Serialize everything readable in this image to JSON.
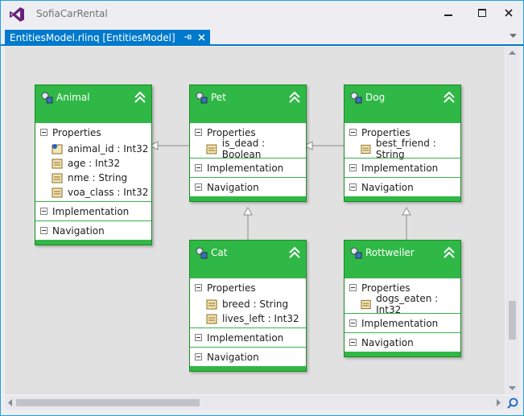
{
  "window": {
    "title": "SofiaCarRental",
    "accent": "#007acc",
    "controls": {
      "minimize": "—",
      "maximize": "☐",
      "close": "✕"
    }
  },
  "tab": {
    "label": "EntitiesModel.rlinq [EntitiesModel]",
    "pin": "⊣",
    "close": "✕"
  },
  "colors": {
    "entity_header": "#30b847",
    "canvas": "#e1e1e1"
  },
  "entities": {
    "animal": {
      "name": "Animal",
      "properties_label": "Properties",
      "properties": [
        {
          "label": "animal_id : Int32",
          "icon": "key-property-icon"
        },
        {
          "label": "age : Int32",
          "icon": "property-icon"
        },
        {
          "label": "nme : String",
          "icon": "property-icon"
        },
        {
          "label": "voa_class : Int32",
          "icon": "property-icon"
        }
      ],
      "implementation_label": "Implementation",
      "navigation_label": "Navigation"
    },
    "pet": {
      "name": "Pet",
      "properties_label": "Properties",
      "properties": [
        {
          "label": "is_dead : Boolean",
          "icon": "property-icon"
        }
      ],
      "implementation_label": "Implementation",
      "navigation_label": "Navigation"
    },
    "dog": {
      "name": "Dog",
      "properties_label": "Properties",
      "properties": [
        {
          "label": "best_friend : String",
          "icon": "property-icon"
        }
      ],
      "implementation_label": "Implementation",
      "navigation_label": "Navigation"
    },
    "cat": {
      "name": "Cat",
      "properties_label": "Properties",
      "properties": [
        {
          "label": "breed : String",
          "icon": "property-icon"
        },
        {
          "label": "lives_left : Int32",
          "icon": "property-icon"
        }
      ],
      "implementation_label": "Implementation",
      "navigation_label": "Navigation"
    },
    "rottweiler": {
      "name": "Rottweiler",
      "properties_label": "Properties",
      "properties": [
        {
          "label": "dogs_eaten : Int32",
          "icon": "property-icon"
        }
      ],
      "implementation_label": "Implementation",
      "navigation_label": "Navigation"
    }
  }
}
